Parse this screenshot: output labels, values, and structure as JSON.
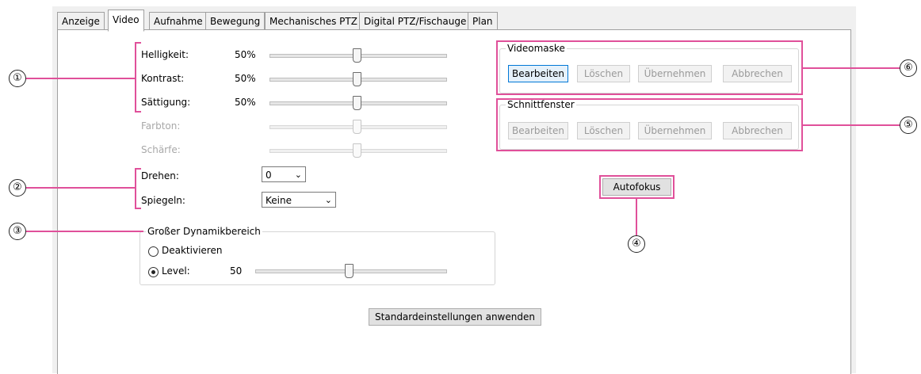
{
  "tabs": [
    "Anzeige",
    "Video",
    "Aufnahme",
    "Bewegung",
    "Mechanisches PTZ",
    "Digital PTZ/Fischauge",
    "Plan"
  ],
  "image": {
    "brightness": {
      "label": "Helligkeit:",
      "value": "50%",
      "level": 0.5
    },
    "contrast": {
      "label": "Kontrast:",
      "value": "50%",
      "level": 0.5
    },
    "saturation": {
      "label": "Sättigung:",
      "value": "50%",
      "level": 0.5
    },
    "hue": {
      "label": "Farbton:",
      "level": 0.5
    },
    "sharpness": {
      "label": "Schärfe:",
      "level": 0.5
    }
  },
  "rotate": {
    "label": "Drehen:",
    "value": "0"
  },
  "mirror": {
    "label": "Spiegeln:",
    "value": "Keine"
  },
  "wdr": {
    "title": "Großer Dynamikbereich",
    "deactivate_label": "Deaktivieren",
    "level_label": "Level:",
    "level_value": "50",
    "level": 0.5
  },
  "defaults_button": "Standardeinstellungen anwenden",
  "video_mask": {
    "title": "Videomaske",
    "edit": "Bearbeiten",
    "delete": "Löschen",
    "apply": "Übernehmen",
    "cancel": "Abbrechen"
  },
  "crop_window": {
    "title": "Schnittfenster",
    "edit": "Bearbeiten",
    "delete": "Löschen",
    "apply": "Übernehmen",
    "cancel": "Abbrechen"
  },
  "autofocus_button": "Autofokus",
  "callouts": {
    "c1": "①",
    "c2": "②",
    "c3": "③",
    "c4": "④",
    "c5": "⑤",
    "c6": "⑥"
  },
  "colors": {
    "highlight": "#e0509a",
    "panel_border": "#a0a0a0"
  }
}
